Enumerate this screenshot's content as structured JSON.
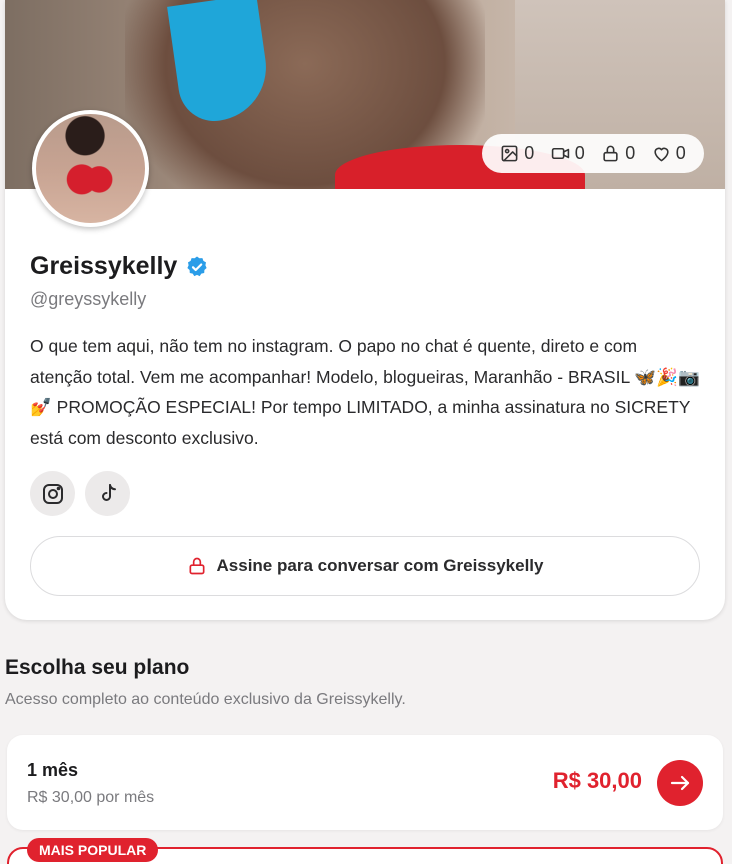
{
  "profile": {
    "name": "Greissykelly",
    "handle": "@greyssykelly",
    "bio": "O que tem aqui, não tem no instagram. O papo no chat é quente, direto e com atenção total. Vem me acompanhar! Modelo, blogueiras, Maranhão - BRASIL 🦋🎉📷💅 PROMOÇÃO ESPECIAL! Por tempo LIMITADO, a minha assinatura no SICRETY está com desconto exclusivo.",
    "verified": true,
    "stats": {
      "photos": "0",
      "videos": "0",
      "locked": "0",
      "likes": "0"
    },
    "socials": [
      "instagram-icon",
      "tiktok-icon"
    ],
    "chat_button_label": "Assine para conversar com Greissykelly"
  },
  "plans": {
    "title": "Escolha seu plano",
    "subtitle": "Acesso completo ao conteúdo exclusivo da Greissykelly.",
    "items": [
      {
        "name": "1 mês",
        "per_month": "R$ 30,00 por mês",
        "price": "R$ 30,00"
      }
    ],
    "popular_badge": "MAIS POPULAR"
  },
  "colors": {
    "accent": "#e0222e",
    "verified": "#2b9de8"
  }
}
